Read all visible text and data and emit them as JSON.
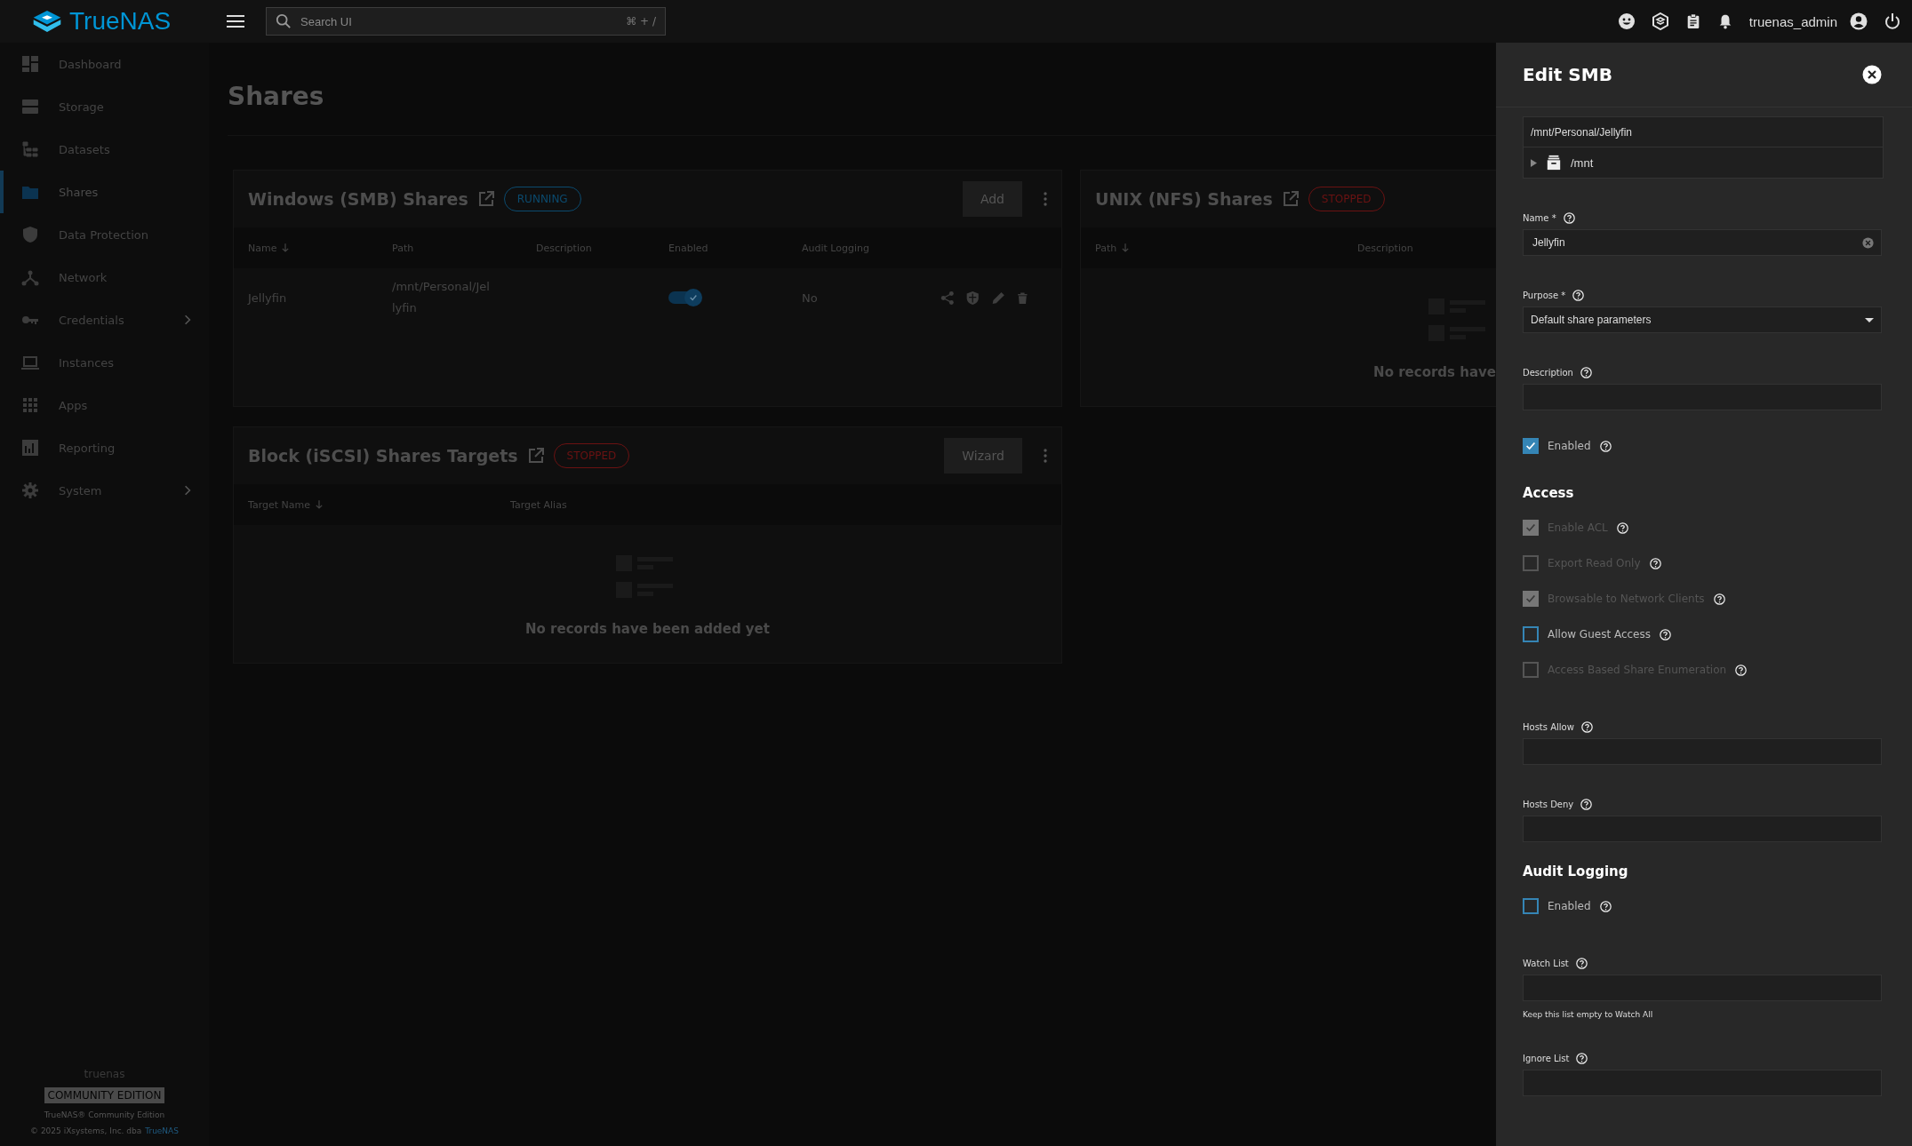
{
  "header": {
    "brand": "TrueNAS",
    "search": {
      "placeholder": "Search UI",
      "shortcut": "⌘ + /"
    },
    "username": "truenas_admin"
  },
  "sidebar": {
    "items": [
      {
        "label": "Dashboard",
        "selected": false,
        "has_submenu": false
      },
      {
        "label": "Storage",
        "selected": false,
        "has_submenu": false
      },
      {
        "label": "Datasets",
        "selected": false,
        "has_submenu": false
      },
      {
        "label": "Shares",
        "selected": true,
        "has_submenu": false
      },
      {
        "label": "Data Protection",
        "selected": false,
        "has_submenu": false
      },
      {
        "label": "Network",
        "selected": false,
        "has_submenu": false
      },
      {
        "label": "Credentials",
        "selected": false,
        "has_submenu": true
      },
      {
        "label": "Instances",
        "selected": false,
        "has_submenu": false
      },
      {
        "label": "Apps",
        "selected": false,
        "has_submenu": false
      },
      {
        "label": "Reporting",
        "selected": false,
        "has_submenu": false
      },
      {
        "label": "System",
        "selected": false,
        "has_submenu": true
      }
    ],
    "footer": {
      "hostname": "truenas",
      "edition_badge": "COMMUNITY EDITION",
      "product": "TrueNAS® Community Edition",
      "copyright": "© 2025 iXsystems, Inc. dba",
      "copyright_link": "TrueNAS"
    }
  },
  "page": {
    "title": "Shares",
    "cards": [
      {
        "title": "Windows (SMB) Shares",
        "status": "RUNNING",
        "color": "#0b4a6e",
        "action": "Add",
        "columns": [
          {
            "label": "Name",
            "sorted": true
          },
          {
            "label": "Path",
            "sorted": false
          },
          {
            "label": "Description",
            "sorted": false
          },
          {
            "label": "Enabled",
            "sorted": false
          },
          {
            "label": "Audit Logging",
            "sorted": false
          }
        ],
        "rows": [
          {
            "name": "Jellyfin",
            "path": "/mnt/Personal/Jellyfin",
            "description": "",
            "enabled": true,
            "audit_logging": "No"
          }
        ]
      },
      {
        "title": "UNIX (NFS) Shares",
        "status": "STOPPED",
        "color": "#6a1212",
        "columns": [
          {
            "label": "Path",
            "sorted": true
          },
          {
            "label": "Description",
            "sorted": false
          }
        ],
        "empty_text": "No records have"
      },
      {
        "title": "Block (iSCSI) Shares Targets",
        "status": "STOPPED",
        "color": "#6a1212",
        "action": "Wizard",
        "columns": [
          {
            "label": "Target Name",
            "sorted": true
          },
          {
            "label": "Target Alias",
            "sorted": false
          }
        ],
        "empty_text": "No records have been added yet"
      }
    ]
  },
  "panel": {
    "title": "Edit SMB",
    "items": [
      {
        "kind": "path",
        "value": "/mnt/Personal/Jellyfin",
        "node": "/mnt"
      },
      {
        "kind": "input",
        "label": "Name *",
        "value": "Jellyfin",
        "clearable": true
      },
      {
        "kind": "select",
        "label": "Purpose *",
        "value": "Default share parameters"
      },
      {
        "kind": "input",
        "label": "Description",
        "value": "",
        "clearable": false
      },
      {
        "kind": "checkbox",
        "label": "Enabled",
        "checked": true,
        "disabled": false
      },
      {
        "kind": "heading",
        "label": "Access"
      },
      {
        "kind": "checkbox",
        "label": "Enable ACL",
        "checked": true,
        "disabled": true
      },
      {
        "kind": "checkbox",
        "label": "Export Read Only",
        "checked": false,
        "disabled": true
      },
      {
        "kind": "checkbox",
        "label": "Browsable to Network Clients",
        "checked": true,
        "disabled": true
      },
      {
        "kind": "checkbox",
        "label": "Allow Guest Access",
        "checked": false,
        "disabled": false
      },
      {
        "kind": "checkbox",
        "label": "Access Based Share Enumeration",
        "checked": false,
        "disabled": true
      },
      {
        "kind": "input",
        "label": "Hosts Allow",
        "value": "",
        "clearable": false
      },
      {
        "kind": "input",
        "label": "Hosts Deny",
        "value": "",
        "clearable": false
      },
      {
        "kind": "heading",
        "label": "Audit Logging"
      },
      {
        "kind": "checkbox",
        "label": "Enabled",
        "checked": false,
        "disabled": false
      },
      {
        "kind": "input",
        "label": "Watch List",
        "value": "",
        "clearable": false,
        "hint": "Keep this list empty to Watch All"
      },
      {
        "kind": "input",
        "label": "Ignore List",
        "value": "",
        "clearable": false
      }
    ]
  }
}
